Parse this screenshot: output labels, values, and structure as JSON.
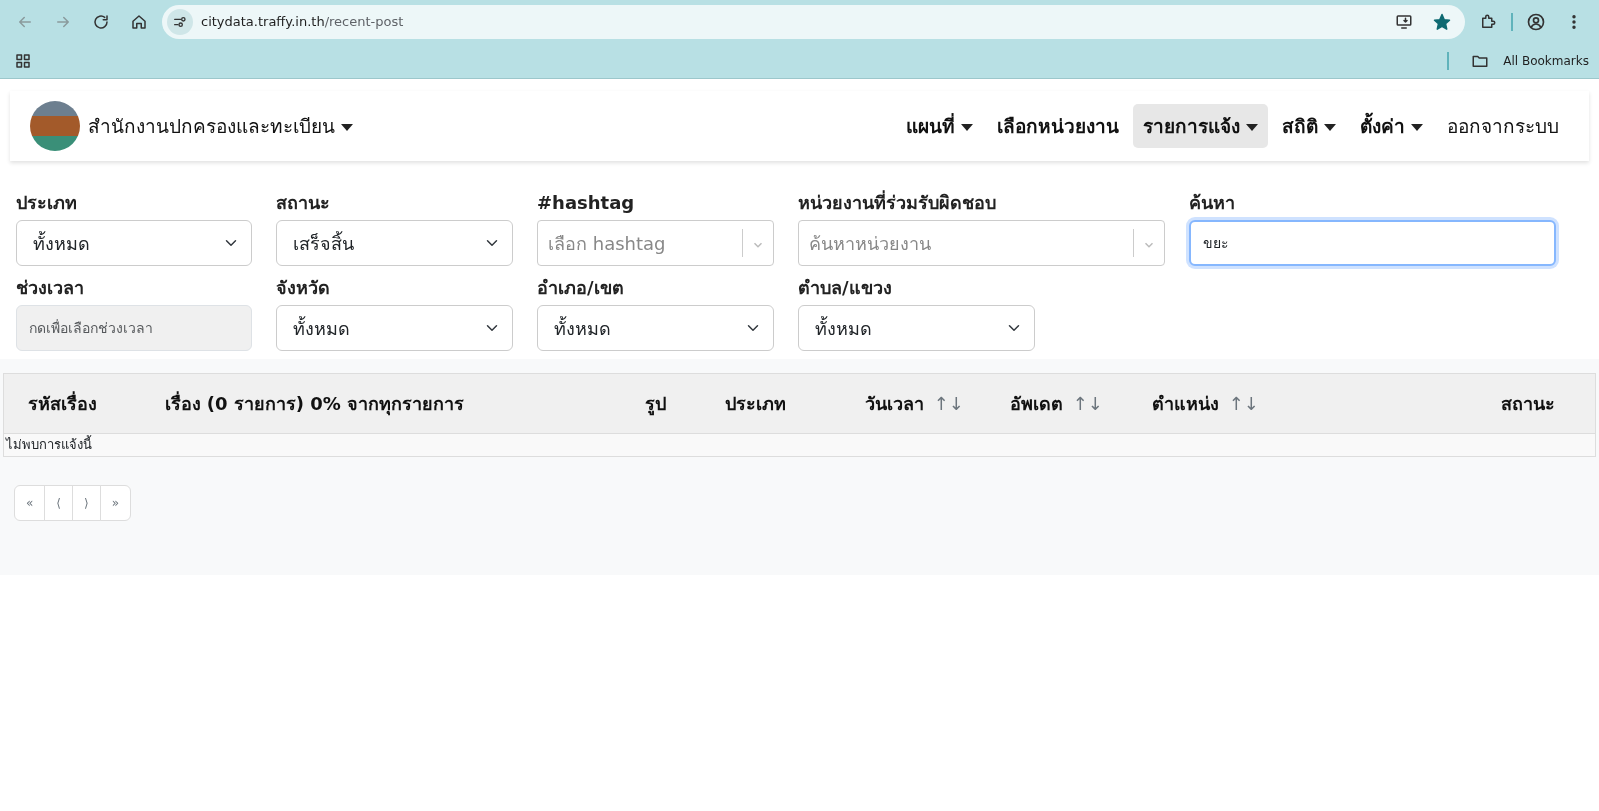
{
  "browser": {
    "url": {
      "host": "citydata.traffy.in.th",
      "path": "/recent-post"
    },
    "bookmark_starred": true,
    "bookmarks_label": "All Bookmarks"
  },
  "navbar": {
    "brand": "สำนักงานปกครองและทะเบียน",
    "brand_dropdown": true,
    "items": [
      {
        "label": "แผนที่",
        "kind": "dropdown",
        "selected": false
      },
      {
        "label": "เลือกหน่วยงาน",
        "kind": "link",
        "selected": false
      },
      {
        "label": "รายการแจ้ง",
        "kind": "dropdown",
        "selected": true
      },
      {
        "label": "สถิติ",
        "kind": "dropdown",
        "selected": false
      },
      {
        "label": "ตั้งค่า",
        "kind": "dropdown",
        "selected": false
      },
      {
        "label": "ออกจากระบบ",
        "kind": "logout",
        "selected": false
      }
    ]
  },
  "filters": [
    [
      {
        "label": "ประเภท",
        "kind": "select",
        "value": "ทั้งหมด"
      },
      {
        "label": "สถานะ",
        "kind": "select",
        "value": "เสร็จสิ้น"
      },
      {
        "label": "#hashtag",
        "kind": "multiselect",
        "placeholder": "เลือก hashtag"
      },
      {
        "label": "หน่วยงานที่ร่วมรับผิดชอบ",
        "kind": "multiselect",
        "placeholder": "ค้นหาหน่วยงาน"
      },
      {
        "label": "ค้นหา",
        "kind": "text",
        "value": "ขยะ",
        "focused": true
      }
    ],
    [
      {
        "label": "ช่วงเวลา",
        "kind": "date",
        "placeholder": "กดเพื่อเลือกช่วงเวลา"
      },
      {
        "label": "จังหวัด",
        "kind": "select",
        "value": "ทั้งหมด"
      },
      {
        "label": "อำเภอ/เขต",
        "kind": "select",
        "value": "ทั้งหมด"
      },
      {
        "label": "ตำบล/แขวง",
        "kind": "select",
        "value": "ทั้งหมด"
      }
    ]
  ],
  "table": {
    "columns": [
      {
        "label": "รหัสเรื่อง"
      },
      {
        "label": "เรื่อง (0 รายการ) 0% จากทุกรายการ"
      },
      {
        "label": "รูป"
      },
      {
        "label": "ประเภท"
      },
      {
        "label": "วันเวลา",
        "sort": "↑↓"
      },
      {
        "label": "อัพเดต",
        "sort": "↑↓"
      },
      {
        "label": "ตำแหน่ง",
        "sort": "↑↓"
      },
      {
        "label": "สถานะ"
      }
    ],
    "empty_message": "ไม่พบการแจ้งนี้"
  },
  "pagination": [
    "«",
    "⟨",
    "⟩",
    "»"
  ]
}
